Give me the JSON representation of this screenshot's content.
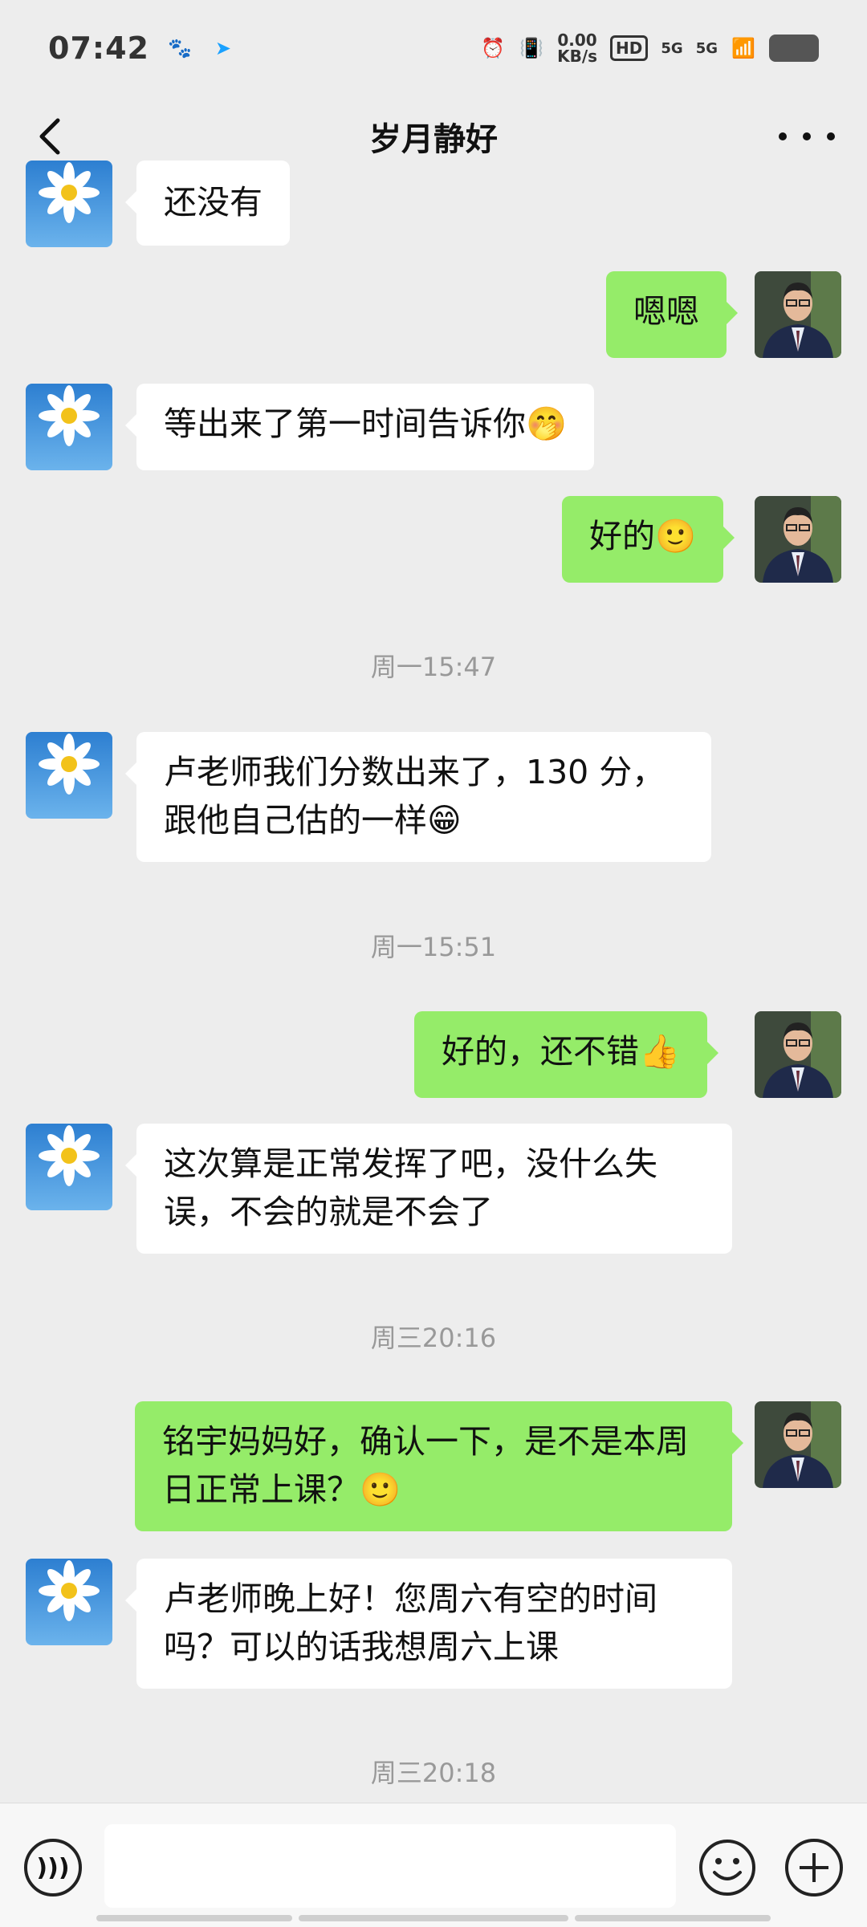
{
  "status_bar": {
    "time": "07:42",
    "net_speed_value": "0.00",
    "net_speed_unit": "KB/s",
    "hd_badge": "HD",
    "signal1": "5G",
    "signal2": "5G"
  },
  "header": {
    "title": "岁月静好"
  },
  "messages": [
    {
      "side": "in",
      "text": "还没有"
    },
    {
      "side": "out",
      "text": "嗯嗯"
    },
    {
      "side": "in",
      "text": "等出来了第一时间告诉你🤭"
    },
    {
      "side": "out",
      "text": "好的🙂"
    },
    {
      "side": "in",
      "text": "卢老师我们分数出来了，130 分，跟他自己估的一样😁"
    },
    {
      "side": "out",
      "text": "好的，还不错👍"
    },
    {
      "side": "in",
      "text": "这次算是正常发挥了吧，没什么失误，不会的就是不会了"
    },
    {
      "side": "out",
      "text": "铭宇妈妈好，确认一下，是不是本周日正常上课？🙂"
    },
    {
      "side": "in",
      "text": "卢老师晚上好！您周六有空的时间吗？可以的话我想周六上课"
    }
  ],
  "timestamps": [
    "周一15:47",
    "周一15:51",
    "周三20:16",
    "周三20:18"
  ],
  "input": {
    "value": "",
    "placeholder": ""
  },
  "colors": {
    "background": "#ededed",
    "bubble_in": "#ffffff",
    "bubble_out": "#95ec69"
  },
  "icons": {
    "back": "chevron-left-icon",
    "more": "more-dots-icon",
    "voice": "voice-icon",
    "emoji": "emoji-icon",
    "plus": "plus-icon"
  }
}
